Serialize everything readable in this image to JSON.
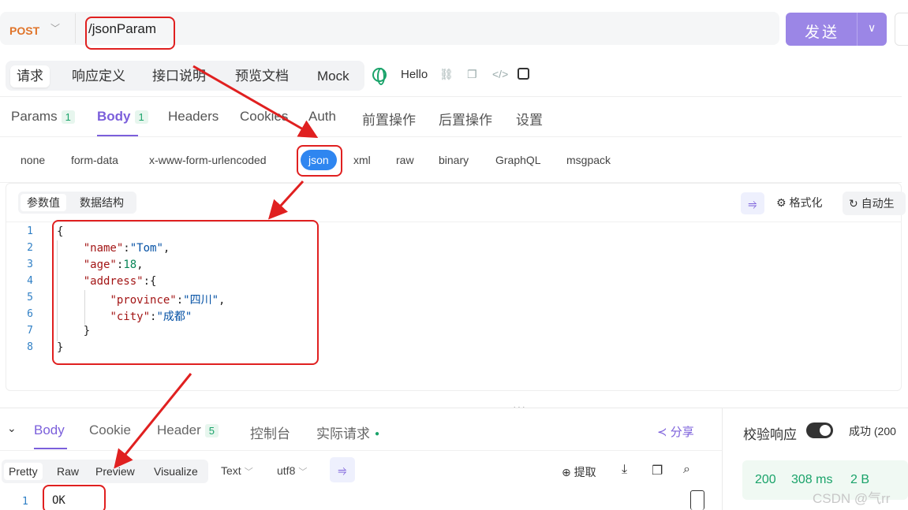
{
  "request": {
    "method": "POST",
    "url": "/jsonParam",
    "send_label": "发送"
  },
  "top_tabs": [
    "请求",
    "响应定义",
    "接口说明",
    "预览文档",
    "Mock"
  ],
  "environment": "Hello",
  "param_tabs": [
    {
      "label": "Params",
      "badge": "1"
    },
    {
      "label": "Body",
      "badge": "1"
    },
    {
      "label": "Headers"
    },
    {
      "label": "Cookies"
    },
    {
      "label": "Auth"
    },
    {
      "label": "前置操作"
    },
    {
      "label": "后置操作"
    },
    {
      "label": "设置"
    }
  ],
  "body_types": [
    "none",
    "form-data",
    "x-www-form-urlencoded",
    "json",
    "xml",
    "raw",
    "binary",
    "GraphQL",
    "msgpack"
  ],
  "editor": {
    "subtabs": [
      "参数值",
      "数据结构"
    ],
    "format_label": "格式化",
    "auto_label": "自动生",
    "line_numbers": [
      "1",
      "2",
      "3",
      "4",
      "5",
      "6",
      "7",
      "8"
    ]
  },
  "response": {
    "tabs": [
      {
        "label": "Body"
      },
      {
        "label": "Cookie"
      },
      {
        "label": "Header",
        "badge": "5"
      },
      {
        "label": "控制台"
      },
      {
        "label": "实际请求"
      }
    ],
    "share_label": "分享",
    "verify_label": "校验响应",
    "success_label": "成功 (200",
    "format_tabs": [
      "Pretty",
      "Raw",
      "Preview",
      "Visualize"
    ],
    "text_select": "Text",
    "encoding_select": "utf8",
    "extract_label": "提取",
    "status_code": "200",
    "time": "308 ms",
    "size": "2 B",
    "line_number": "1",
    "body_text": "OK"
  },
  "watermark": "CSDN @气rr",
  "colors": {
    "accent": "#7b5fdb",
    "send_button": "#9b86e6",
    "method": "#e0742a",
    "json_active": "#2f86f0",
    "success": "#1aa36a",
    "annotation": "#e02020"
  }
}
